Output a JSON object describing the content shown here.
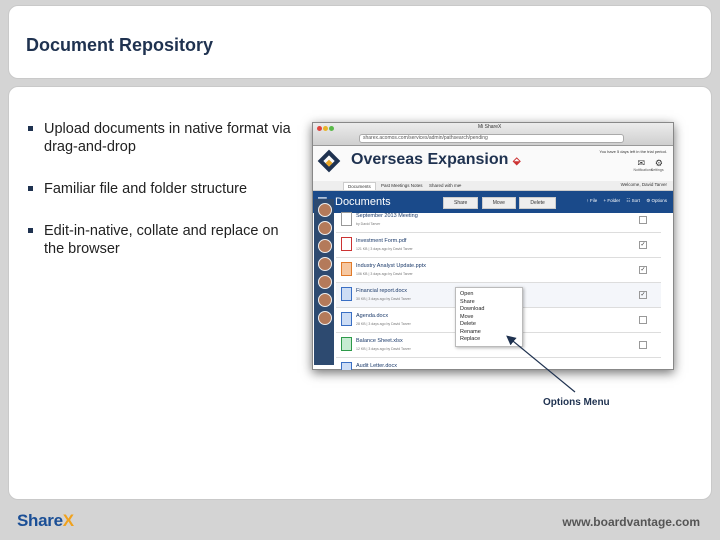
{
  "slide": {
    "title": "Document Repository",
    "bullets": [
      "Upload documents in native format via drag-and-drop",
      "Familiar file and folder structure",
      "Edit-in-native, collate and replace on the browser"
    ],
    "callout": "Options Menu"
  },
  "footer": {
    "logo_main": "Share",
    "logo_accent": "X",
    "website": "www.boardvantage.com"
  },
  "browser": {
    "tab_title": "Mi ShareX",
    "url": "sharex.acomos.com/services/admin/pathsearch/pending"
  },
  "app": {
    "title": "Overseas Expansion",
    "notice": "You have 5 days left in the trial period.",
    "notifications_label": "Notifications",
    "settings_label": "Settings",
    "tabs": [
      "Documents",
      "Past Meetings Notes",
      "Shared with me",
      "+"
    ],
    "welcome": "Welcome, David Tarver",
    "section_title": "Documents",
    "bar_actions": [
      "↑ File",
      "+ Folder",
      "☷ Sort",
      "⚙ Options"
    ],
    "action_buttons": [
      "Share",
      "Move",
      "Delete"
    ],
    "documents": [
      {
        "name": "September 2013 Meeting",
        "meta": "by David Tarver",
        "checked": false
      },
      {
        "name": "Investment Form.pdf",
        "meta": "121 KB | 3 days ago by David Tarver",
        "checked": true
      },
      {
        "name": "Industry Analyst Update.pptx",
        "meta": "106 KB | 3 days ago by David Tarver",
        "checked": true
      },
      {
        "name": "Financial report.docx",
        "meta": "30 KB | 3 days ago by David Tarver",
        "checked": true
      },
      {
        "name": "Agenda.docx",
        "meta": "28 KB | 3 days ago by David Tarver",
        "checked": false
      },
      {
        "name": "Balance Sheet.xlsx",
        "meta": "12 KB | 3 days ago by David Tarver",
        "checked": false
      },
      {
        "name": "Audit Letter.docx",
        "meta": "",
        "checked": false
      }
    ],
    "context_menu": [
      "Open",
      "Share",
      "Download",
      "Move",
      "Delete",
      "Rename",
      "Replace"
    ]
  },
  "colors": {
    "brand_navy": "#1f3250",
    "brand_blue": "#1a4a8a",
    "accent_orange": "#f0a21e"
  }
}
